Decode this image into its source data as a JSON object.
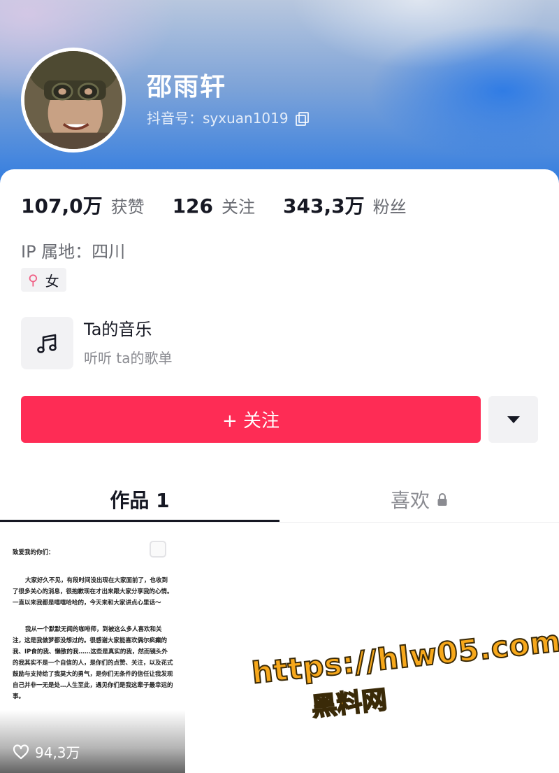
{
  "profile": {
    "name": "邵雨轩",
    "douyin_id": "抖音号：syxuan1019"
  },
  "stats": [
    {
      "value": "107,0万",
      "label": "获赞"
    },
    {
      "value": "126",
      "label": "关注"
    },
    {
      "value": "343,3万",
      "label": "粉丝"
    }
  ],
  "ip_location": "IP 属地：四川",
  "gender": {
    "icon": "female-icon",
    "label": "女"
  },
  "music": {
    "title": "Ta的音乐",
    "subtitle": "听听 ta的歌单",
    "icon": "music-note-icon"
  },
  "follow_button": "+ 关注",
  "tabs": [
    {
      "label": "作品 1"
    },
    {
      "label": "喜欢"
    }
  ],
  "video": {
    "greeting": "致爱我的你们：",
    "paragraphs": [
      "大家好久不见，有段时间没出现在大家面前了，也收到了很多关心的消息，很抱歉现在才出来跟大家分享我的心情。一直以来我都是嘻嘻哈哈的，今天来和大家讲点心里话～",
      "我从一个默默无闻的咖啡师，到被这么多人喜欢和关注，这是我做梦都没想过的。很感谢大家能喜欢偶尔疯癫的我、IP食的我、懒散的我……这些是真实的我，然而镜头外的我其实不是一个自信的人，是你们的点赞、关注，以及花式鼓励与支持给了我莫大的勇气，是你们无条件的信任让我发现自己并非一无是处…人生至此，遇见你们是我这辈子最幸运的事。"
    ],
    "likes": "94,3万"
  },
  "watermark": {
    "line1": "https://hlw05.com",
    "line2": "黑料网"
  },
  "colors": {
    "accent": "#fe2c55",
    "female": "#f05d83",
    "watermark": "#f7a81b"
  }
}
